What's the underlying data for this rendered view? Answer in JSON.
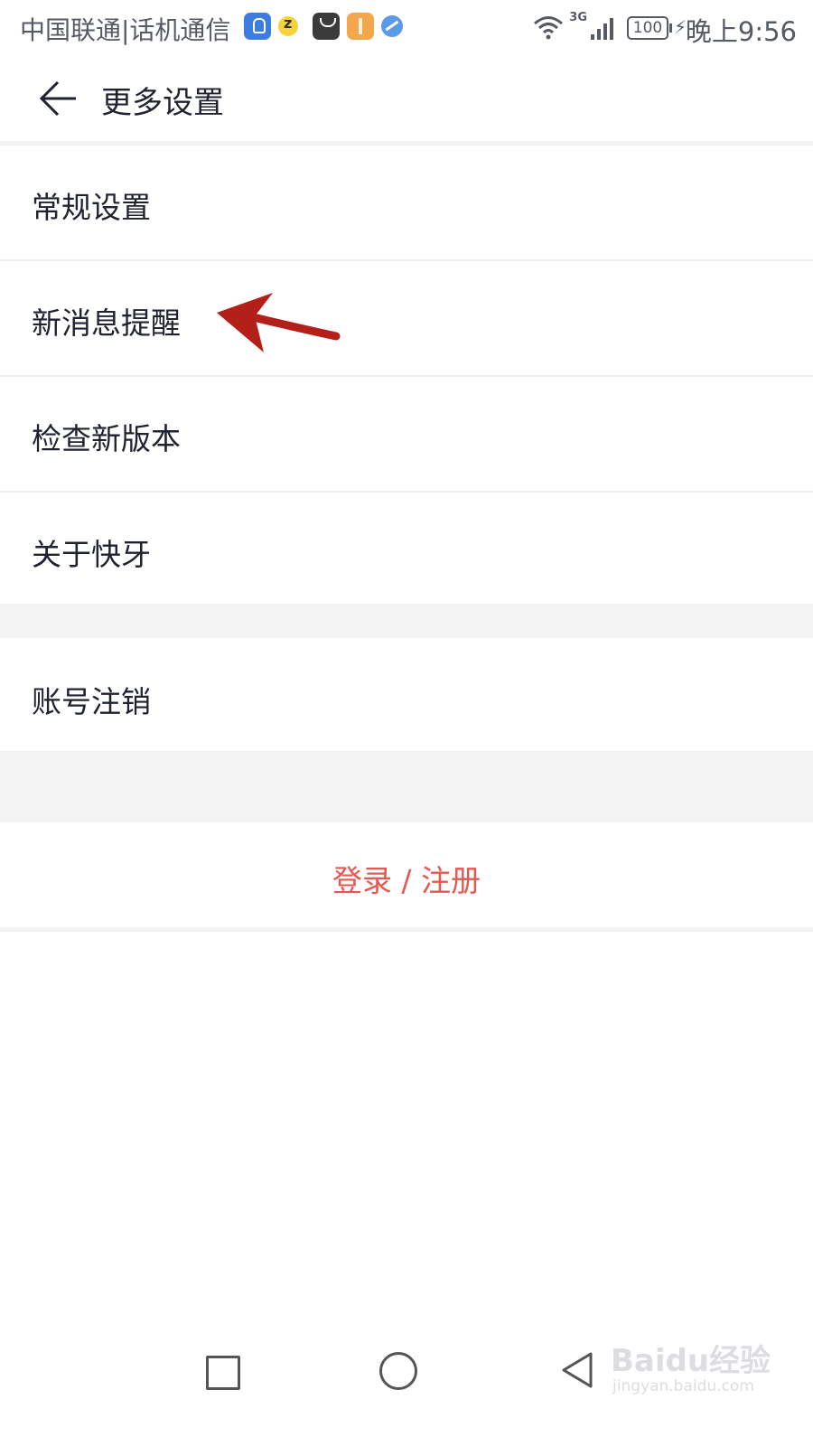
{
  "status_bar": {
    "carrier": "中国联通|话机通信",
    "network": "3G",
    "battery": "100",
    "time": "晚上9:56",
    "notification_icons": [
      "lightbulb-icon",
      "yellow-app-icon",
      "huawei-store-icon",
      "orange-app-icon",
      "globe-icon"
    ]
  },
  "header": {
    "title": "更多设置"
  },
  "menu": {
    "items": [
      {
        "label": "常规设置"
      },
      {
        "label": "新消息提醒"
      },
      {
        "label": "检查新版本"
      },
      {
        "label": "关于快牙"
      }
    ],
    "account_cancel": "账号注销",
    "login_register": "登录 / 注册"
  },
  "watermark": {
    "main": "Baidu经验",
    "sub": "jingyan.baidu.com"
  },
  "colors": {
    "accent_red": "#e5584f",
    "arrow_red": "#b3201a",
    "text": "#1f2330",
    "separator": "#f3f3f3"
  }
}
